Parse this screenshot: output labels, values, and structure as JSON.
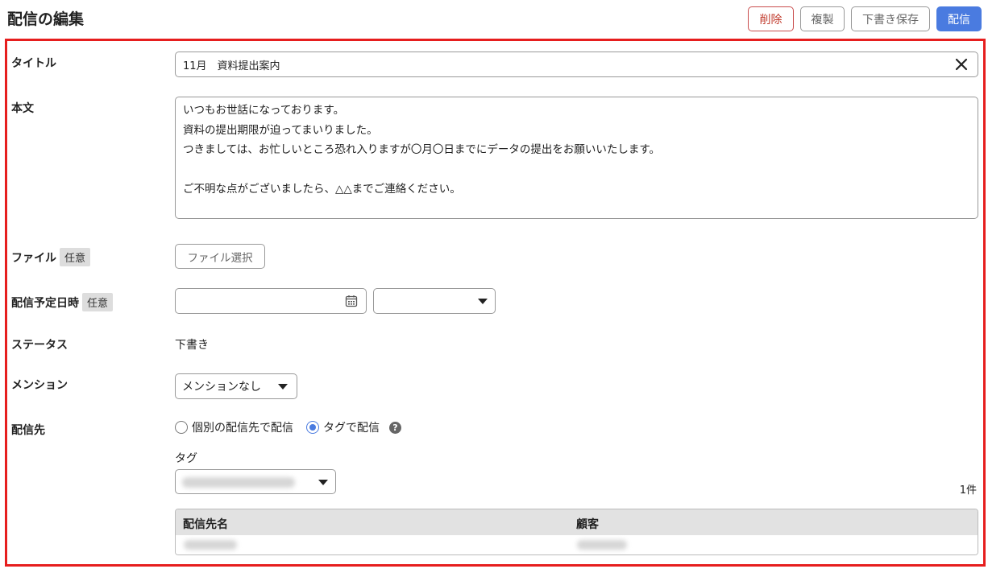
{
  "header": {
    "title": "配信の編集",
    "buttons": {
      "delete": "削除",
      "copy": "複製",
      "save_draft": "下書き保存",
      "send": "配信"
    }
  },
  "form": {
    "title": {
      "label": "タイトル",
      "value": "11月　資料提出案内"
    },
    "body": {
      "label": "本文",
      "value": "いつもお世話になっております。\n資料の提出期限が迫ってまいりました。\nつきましては、お忙しいところ恐れ入りますが〇月〇日までにデータの提出をお願いいたします。\n\nご不明な点がございましたら、△△までご連絡ください。"
    },
    "file": {
      "label": "ファイル",
      "optional": "任意",
      "button": "ファイル選択"
    },
    "schedule": {
      "label": "配信予定日時",
      "optional": "任意",
      "date_value": "",
      "time_value": ""
    },
    "status": {
      "label": "ステータス",
      "value": "下書き"
    },
    "mention": {
      "label": "メンション",
      "value": "メンションなし"
    },
    "destination": {
      "label": "配信先",
      "options": [
        "個別の配信先で配信",
        "タグで配信"
      ],
      "selected": "タグで配信",
      "help": "?",
      "tag_label": "タグ",
      "count": "1件",
      "table": {
        "columns": [
          "配信先名",
          "顧客"
        ]
      }
    }
  },
  "colors": {
    "accent": "#4a7be0",
    "danger": "#c0392b",
    "highlight_frame": "#e61e1e"
  }
}
